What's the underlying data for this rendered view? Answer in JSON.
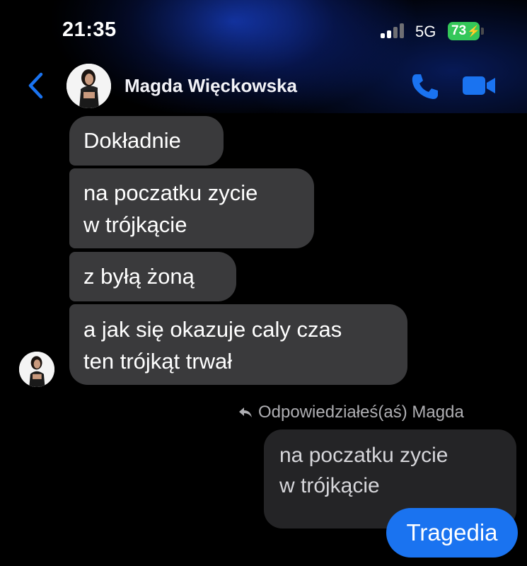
{
  "status_bar": {
    "time": "21:35",
    "network": "5G",
    "battery": "73"
  },
  "header": {
    "contact_name": "Magda Więckowska"
  },
  "messages": [
    {
      "from": "contact",
      "text": "Dokładnie"
    },
    {
      "from": "contact",
      "text": "na poczatku zycie\nw trójkącie"
    },
    {
      "from": "contact",
      "text": "z byłą żoną"
    },
    {
      "from": "contact",
      "text": "a jak się okazuje caly czas\nten trójkąt trwał"
    }
  ],
  "reply": {
    "label": "Odpowiedziałeś(aś) Magda",
    "quoted_text": "na poczatku zycie\nw trójkącie",
    "sent_text": "Tragedia"
  },
  "colors": {
    "accent": "#1a73f0",
    "incoming_bubble": "#3a3a3c",
    "quoted_bubble": "#242426",
    "battery": "#34c759"
  }
}
